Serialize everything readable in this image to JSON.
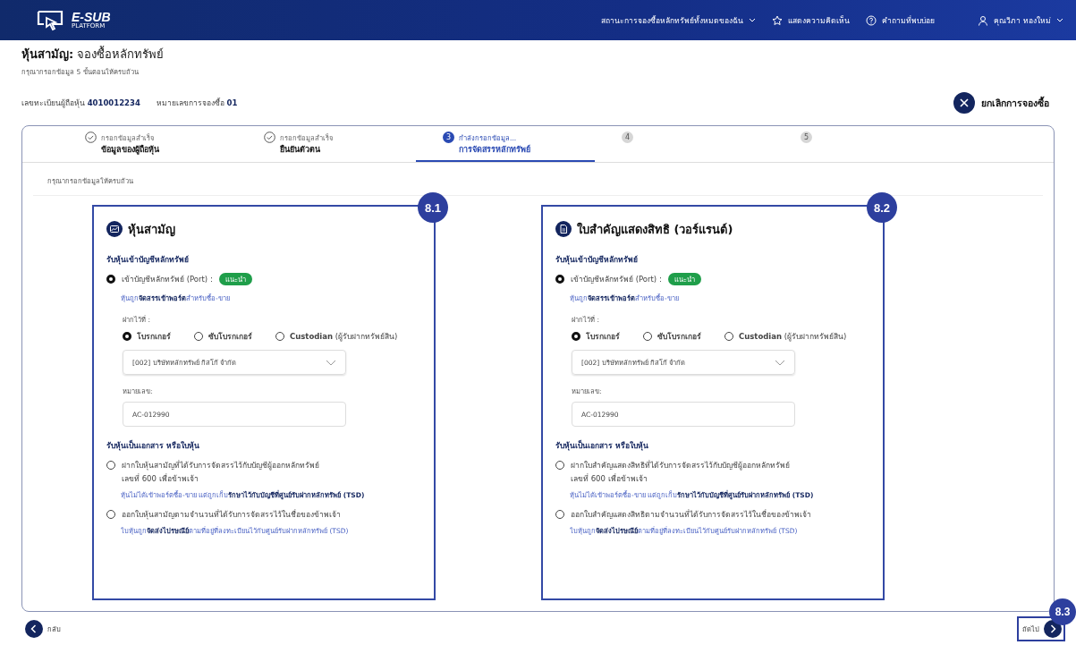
{
  "header": {
    "logo": "E-SUB",
    "logo_sub": "PLATFORM",
    "menu": [
      {
        "label": "สถานะการจองซื้อหลักทรัพย์ทั้งหมดของฉัน",
        "kind": "dropdown"
      },
      {
        "label": "แสดงความคิดเห็น",
        "kind": "star"
      },
      {
        "label": "คำถามที่พบบ่อย",
        "kind": "help"
      }
    ],
    "user": "คุณวิภา ทองใหม่"
  },
  "page": {
    "title_bold": "หุ้นสามัญ:",
    "title": "จองซื้อหลักทรัพย์",
    "subtitle": "กรุณากรอกข้อมูล 5 ขั้นตอนให้ครบถ้วน"
  },
  "info": {
    "items": [
      {
        "label": "เลขทะเบียนผู้ถือหุ้น",
        "value": "4010012234"
      },
      {
        "label": "หมายเลขการจองซื้อ",
        "value": "01"
      }
    ],
    "cancel": "ยกเลิกการจองซื้อ"
  },
  "steps": [
    {
      "kind": "done",
      "caption": "กรอกข้อมูลสำเร็จ",
      "label": "ข้อมูลของผู้ถือหุ้น",
      "selected": false
    },
    {
      "kind": "done",
      "caption": "กรอกข้อมูลสำเร็จ",
      "label": "ยืนยันตัวตน",
      "selected": false
    },
    {
      "kind": "current",
      "number": "3",
      "caption": "กำลังกรอกข้อมูล...",
      "label": "การจัดสรรหลักทรัพย์",
      "selected": true
    },
    {
      "kind": "pending",
      "number": "4",
      "selected": false
    },
    {
      "kind": "pending",
      "number": "5",
      "selected": false
    }
  ],
  "instruction": "กรุณากรอกข้อมูลให้ครบถ้วน",
  "cards": [
    {
      "marker": "8.1",
      "title": "หุ้นสามัญ",
      "port": {
        "heading": "รับหุ้นเข้าบัญชีหลักทรัพย์",
        "option": "เข้าบัญชีหลักทรัพย์ (Port) :",
        "badge": "แนะนำ",
        "selected": true,
        "note": "หุ้นถูก**จัดสรรเข้าพอร์ต**สำหรับซื้อ-ขาย",
        "deposit_label": "ฝากไว้ที่ :",
        "deposit_options": [
          {
            "label": "โบรกเกอร์",
            "selected": true
          },
          {
            "label": "ซับโบรกเกอร์",
            "selected": false
          },
          {
            "label": "**Custodian** (ผู้รับฝากทรัพย์สิน)",
            "selected": false
          }
        ],
        "broker": "[002] บริษัทหลักทรัพย์ กิสโก้ จำกัด",
        "account_label": "หมายเลข:",
        "account_value": "AC-012990"
      },
      "paper": {
        "heading": "รับหุ้นเป็นเอกสาร หรือใบหุ้น",
        "options": [
          {
            "lines": [
              "ฝากใบหุ้นสามัญที่ได้รับการจัดสรรไว้กับบัญชีผู้ออกหลักทรัพย์",
              "เลขที่ 600 เพื่อข้าพเจ้า"
            ],
            "note": "หุ้นไม่ได้เข้าพอร์ตซื้อ-ขาย แต่ถูกเก็บ**รักษาไว้กับบัญชีที่ศูนย์รับฝากหลักทรัพย์ (TSD)**",
            "selected": false
          },
          {
            "lines": [
              "ออกใบหุ้นสามัญตามจำนวนที่ได้รับการจัดสรรไว้ในชื่อของข้าพเจ้า"
            ],
            "note": "ใบหุ้นถูก**จัดส่งไปรษณีย์**ตามที่อยู่ที่ลงทะเบียนไว้กับศูนย์รับฝากหลักทรัพย์ (TSD)",
            "selected": false
          }
        ]
      }
    },
    {
      "marker": "8.2",
      "title": "ใบสำคัญแสดงสิทธิ (วอร์แรนต์)",
      "port": {
        "heading": "รับหุ้นเข้าบัญชีหลักทรัพย์",
        "option": "เข้าบัญชีหลักทรัพย์ (Port) :",
        "badge": "แนะนำ",
        "selected": true,
        "note": "หุ้นถูก**จัดสรรเข้าพอร์ต**สำหรับซื้อ-ขาย",
        "deposit_label": "ฝากไว้ที่ :",
        "deposit_options": [
          {
            "label": "โบรกเกอร์",
            "selected": true
          },
          {
            "label": "ซับโบรกเกอร์",
            "selected": false
          },
          {
            "label": "**Custodian** (ผู้รับฝากทรัพย์สิน)",
            "selected": false
          }
        ],
        "broker": "[002] บริษัทหลักทรัพย์ กิสโก้ จำกัด",
        "account_label": "หมายเลข:",
        "account_value": "AC-012990"
      },
      "paper": {
        "heading": "รับหุ้นเป็นเอกสาร หรือใบหุ้น",
        "options": [
          {
            "lines": [
              "ฝากใบสำคัญแสดงสิทธิที่ได้รับการจัดสรรไว้กับบัญชีผู้ออกหลักทรัพย์",
              "เลขที่ 600 เพื่อข้าพเจ้า"
            ],
            "note": "หุ้นไม่ได้เข้าพอร์ตซื้อ-ขาย แต่ถูกเก็บ**รักษาไว้กับบัญชีที่ศูนย์รับฝากหลักทรัพย์ (TSD)**",
            "selected": false
          },
          {
            "lines": [
              "ออกใบสำคัญแสดงสิทธิตามจำนวนที่ได้รับการจัดสรรไว้ในชื่อของข้าพเจ้า"
            ],
            "note": "ใบหุ้นถูก**จัดส่งไปรษณีย์**ตามที่อยู่ที่ลงทะเบียนไว้กับศูนย์รับฝากหลักทรัพย์ (TSD)",
            "selected": false
          }
        ]
      }
    }
  ],
  "footer": {
    "back": "กลับ",
    "next": "ถัดไป",
    "marker": "8.3"
  }
}
